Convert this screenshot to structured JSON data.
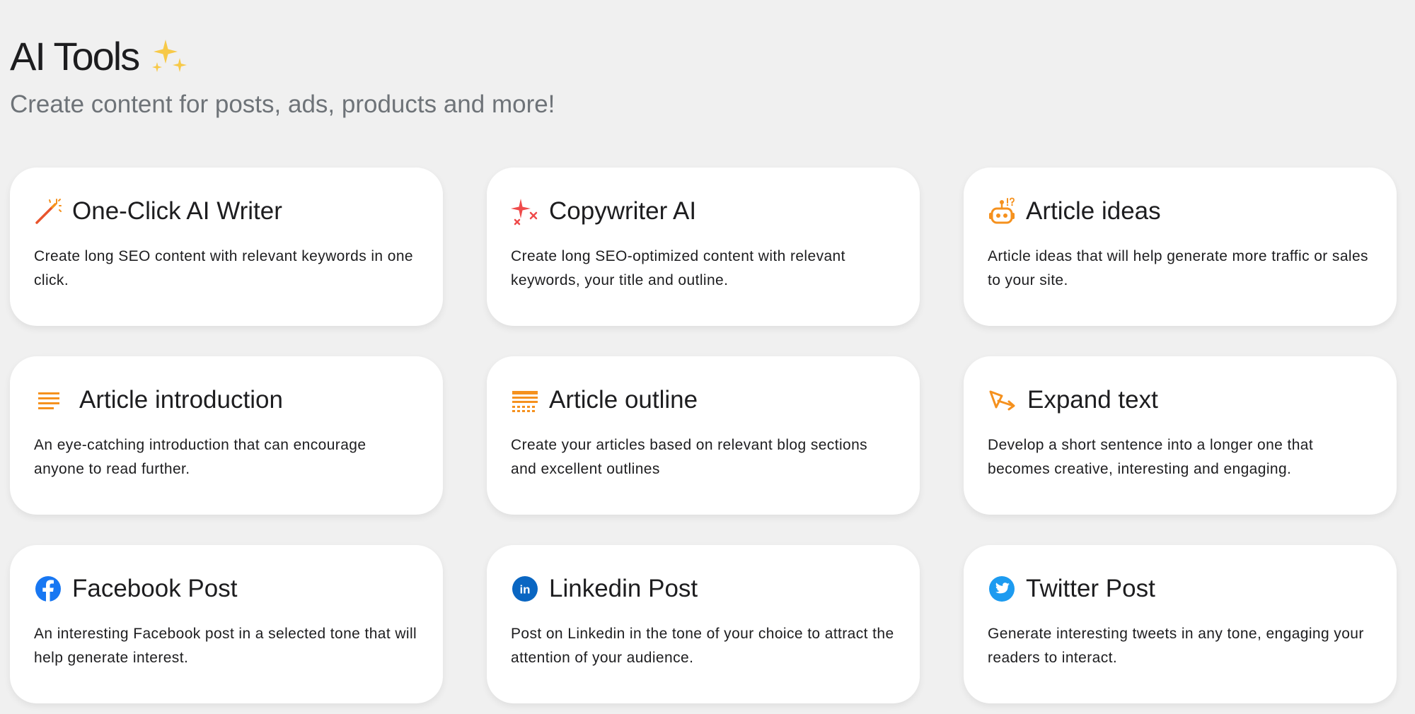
{
  "header": {
    "title": "AI Tools",
    "subtitle": "Create content for posts, ads, products and more!"
  },
  "colors": {
    "background": "#f0f0f0",
    "card": "#ffffff",
    "orange": "#f5911e",
    "red": "#ef4b4b",
    "facebook": "#1877f2",
    "linkedin": "#0a66c2",
    "twitter": "#1d9bf0"
  },
  "tools": [
    {
      "icon": "magic-wand-icon",
      "title": "One-Click AI Writer",
      "description": "Create long SEO content with relevant keywords in one click."
    },
    {
      "icon": "sparkle-stars-icon",
      "title": "Copywriter AI",
      "description": "Create long SEO-optimized content with relevant keywords, your title and outline."
    },
    {
      "icon": "robot-icon",
      "title": "Article ideas",
      "description": "Article ideas that will help generate more traffic or sales to your site."
    },
    {
      "icon": "text-lines-icon",
      "title": "Article introduction",
      "description": "An eye-catching introduction that can encourage anyone to read further."
    },
    {
      "icon": "outline-icon",
      "title": "Article outline",
      "description": "Create your articles based on relevant blog sections and excellent outlines"
    },
    {
      "icon": "expand-pen-icon",
      "title": "Expand text",
      "description": "Develop a short sentence into a longer one that becomes creative, interesting and engaging."
    },
    {
      "icon": "facebook-icon",
      "title": "Facebook Post",
      "description": "An interesting Facebook post in a selected tone that will help generate interest."
    },
    {
      "icon": "linkedin-icon",
      "title": "Linkedin Post",
      "description": "Post on Linkedin in the tone of your choice to attract the attention of your audience."
    },
    {
      "icon": "twitter-icon",
      "title": "Twitter Post",
      "description": "Generate interesting tweets in any tone, engaging your readers to interact."
    }
  ]
}
